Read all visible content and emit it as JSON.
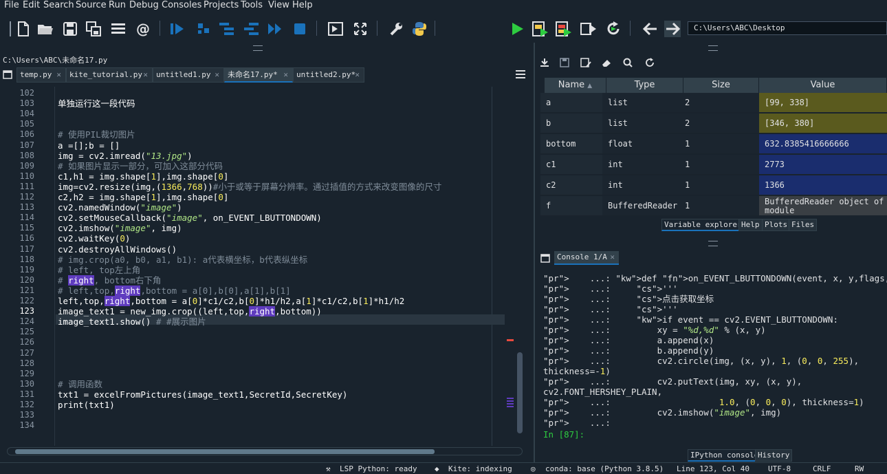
{
  "menu": [
    "File",
    "Edit",
    "Search",
    "Source",
    "Run",
    "Debug",
    "Consoles",
    "Projects",
    "Tools",
    "View",
    "Help"
  ],
  "toolbar": {
    "icons": [
      "new-file-icon",
      "open-folder-icon",
      "save-icon",
      "save-all-icon",
      "outline-icon",
      "at-icon",
      "step-icon",
      "debug-cell-icon",
      "indent-icon",
      "unindent-icon",
      "fast-forward-icon",
      "stop-icon",
      "maximize-pane-icon",
      "fullscreen-icon",
      "preferences-icon",
      "python-path-icon",
      "run-icon",
      "run-cell-icon",
      "run-cell-advance-icon",
      "run-selection-icon",
      "rerun-icon",
      "back-icon",
      "forward-icon"
    ],
    "working_dir": "C:\\Users\\ABC\\Desktop"
  },
  "editor": {
    "file_path": "C:\\Users\\ABC\\未命名17.py",
    "tabs": [
      {
        "label": "temp.py",
        "active": false
      },
      {
        "label": "kite_tutorial.py",
        "active": false
      },
      {
        "label": "untitled1.py",
        "active": false
      },
      {
        "label": "未命名17.py*",
        "active": true
      },
      {
        "label": "untitled2.py*",
        "active": false
      }
    ],
    "current_line": 123,
    "lines": [
      {
        "n": "102",
        "text": ""
      },
      {
        "n": "103",
        "text": "单独运行这一段代码"
      },
      {
        "n": "104",
        "text": ""
      },
      {
        "n": "105",
        "text": ""
      },
      {
        "n": "106",
        "text": "# 使用PIL裁切图片"
      },
      {
        "n": "107",
        "text": "a =[];b = []"
      },
      {
        "n": "108",
        "text": "img = cv2.imread(\"13.jpg\")"
      },
      {
        "n": "109",
        "text": "# 如果图片显示一部分，可加入这部分代码"
      },
      {
        "n": "110",
        "text": "c1,h1 = img.shape[1],img.shape[0]"
      },
      {
        "n": "111",
        "text": "img=cv2.resize(img,(1366,768))#小于或等于屏幕分辨率。通过插值的方式来改变图像的尺寸"
      },
      {
        "n": "112",
        "text": "c2,h2 = img.shape[1],img.shape[0]"
      },
      {
        "n": "113",
        "text": "cv2.namedWindow(\"image\")"
      },
      {
        "n": "114",
        "text": "cv2.setMouseCallback(\"image\", on_EVENT_LBUTTONDOWN)"
      },
      {
        "n": "115",
        "text": "cv2.imshow(\"image\", img)"
      },
      {
        "n": "116",
        "text": "cv2.waitKey(0)"
      },
      {
        "n": "117",
        "text": "cv2.destroyAllWindows()"
      },
      {
        "n": "118",
        "text": "# img.crop(a0, b0, a1, b1): a代表横坐标，b代表纵坐标"
      },
      {
        "n": "119",
        "text": "# left, top左上角"
      },
      {
        "n": "120",
        "text": "# right, bottom右下角"
      },
      {
        "n": "121",
        "text": "# left,top,right,bottom = a[0],b[0],a[1],b[1]"
      },
      {
        "n": "122",
        "text": "left,top,right,bottom = a[0]*c1/c2,b[0]*h1/h2,a[1]*c1/c2,b[1]*h1/h2"
      },
      {
        "n": "123",
        "text": "image_text1 = new_img.crop((left,top,right,bottom))"
      },
      {
        "n": "124",
        "text": "image_text1.show() # #展示图片"
      },
      {
        "n": "125",
        "text": ""
      },
      {
        "n": "126",
        "text": ""
      },
      {
        "n": "127",
        "text": ""
      },
      {
        "n": "128",
        "text": ""
      },
      {
        "n": "129",
        "text": ""
      },
      {
        "n": "130",
        "text": "# 调用函数"
      },
      {
        "n": "131",
        "text": "txt1 = excelFromPictures(image_text1,SecretId,SecretKey)"
      },
      {
        "n": "132",
        "text": "print(txt1)"
      },
      {
        "n": "133",
        "text": ""
      },
      {
        "n": "134",
        "text": ""
      }
    ]
  },
  "variable_explorer": {
    "columns": [
      "Name",
      "Type",
      "Size",
      "Value"
    ],
    "rows": [
      {
        "name": "a",
        "type": "list",
        "size": "2",
        "value": "[99, 338]",
        "color": "#5a5a1e"
      },
      {
        "name": "b",
        "type": "list",
        "size": "2",
        "value": "[346, 380]",
        "color": "#5a5a1e"
      },
      {
        "name": "bottom",
        "type": "float",
        "size": "1",
        "value": "632.8385416666666",
        "color": "#1a2d6e"
      },
      {
        "name": "c1",
        "type": "int",
        "size": "1",
        "value": "2773",
        "color": "#1a2d6e"
      },
      {
        "name": "c2",
        "type": "int",
        "size": "1",
        "value": "1366",
        "color": "#1a2d6e"
      },
      {
        "name": "f",
        "type": "BufferedReader",
        "size": "1",
        "value": "BufferedReader object of _i",
        "value2": "module",
        "color": "#3a3f44"
      }
    ],
    "tabs": [
      {
        "label": "Variable explorer",
        "active": true
      },
      {
        "label": "Help",
        "active": false
      },
      {
        "label": "Plots",
        "active": false
      },
      {
        "label": "Files",
        "active": false
      }
    ]
  },
  "console": {
    "tab_label": "Console 1/A",
    "lines": [
      "    ...: def on_EVENT_LBUTTONDOWN(event, x, y,flags, param):",
      "    ...:     '''",
      "    ...:     点击获取坐标",
      "    ...:     '''",
      "    ...:     if event == cv2.EVENT_LBUTTONDOWN:",
      "    ...:         xy = \"%d,%d\" % (x, y)",
      "    ...:         a.append(x)",
      "    ...:         b.append(y)",
      "    ...:         cv2.circle(img, (x, y), 1, (0, 0, 255),",
      "thickness=-1)",
      "    ...:         cv2.putText(img, xy, (x, y),",
      "cv2.FONT_HERSHEY_PLAIN,",
      "    ...:                     1.0, (0, 0, 0), thickness=1)",
      "    ...:         cv2.imshow(\"image\", img)",
      "    ...: "
    ],
    "prompt": "In [87]:",
    "tabs": [
      {
        "label": "IPython console",
        "active": true
      },
      {
        "label": "History",
        "active": false
      }
    ]
  },
  "statusbar": {
    "lsp": "LSP Python: ready",
    "kite": "Kite: indexing",
    "conda": "conda: base (Python 3.8.5)",
    "position": "Line 123, Col 40",
    "encoding": "UTF-8",
    "eol": "CRLF",
    "mode": "RW"
  }
}
